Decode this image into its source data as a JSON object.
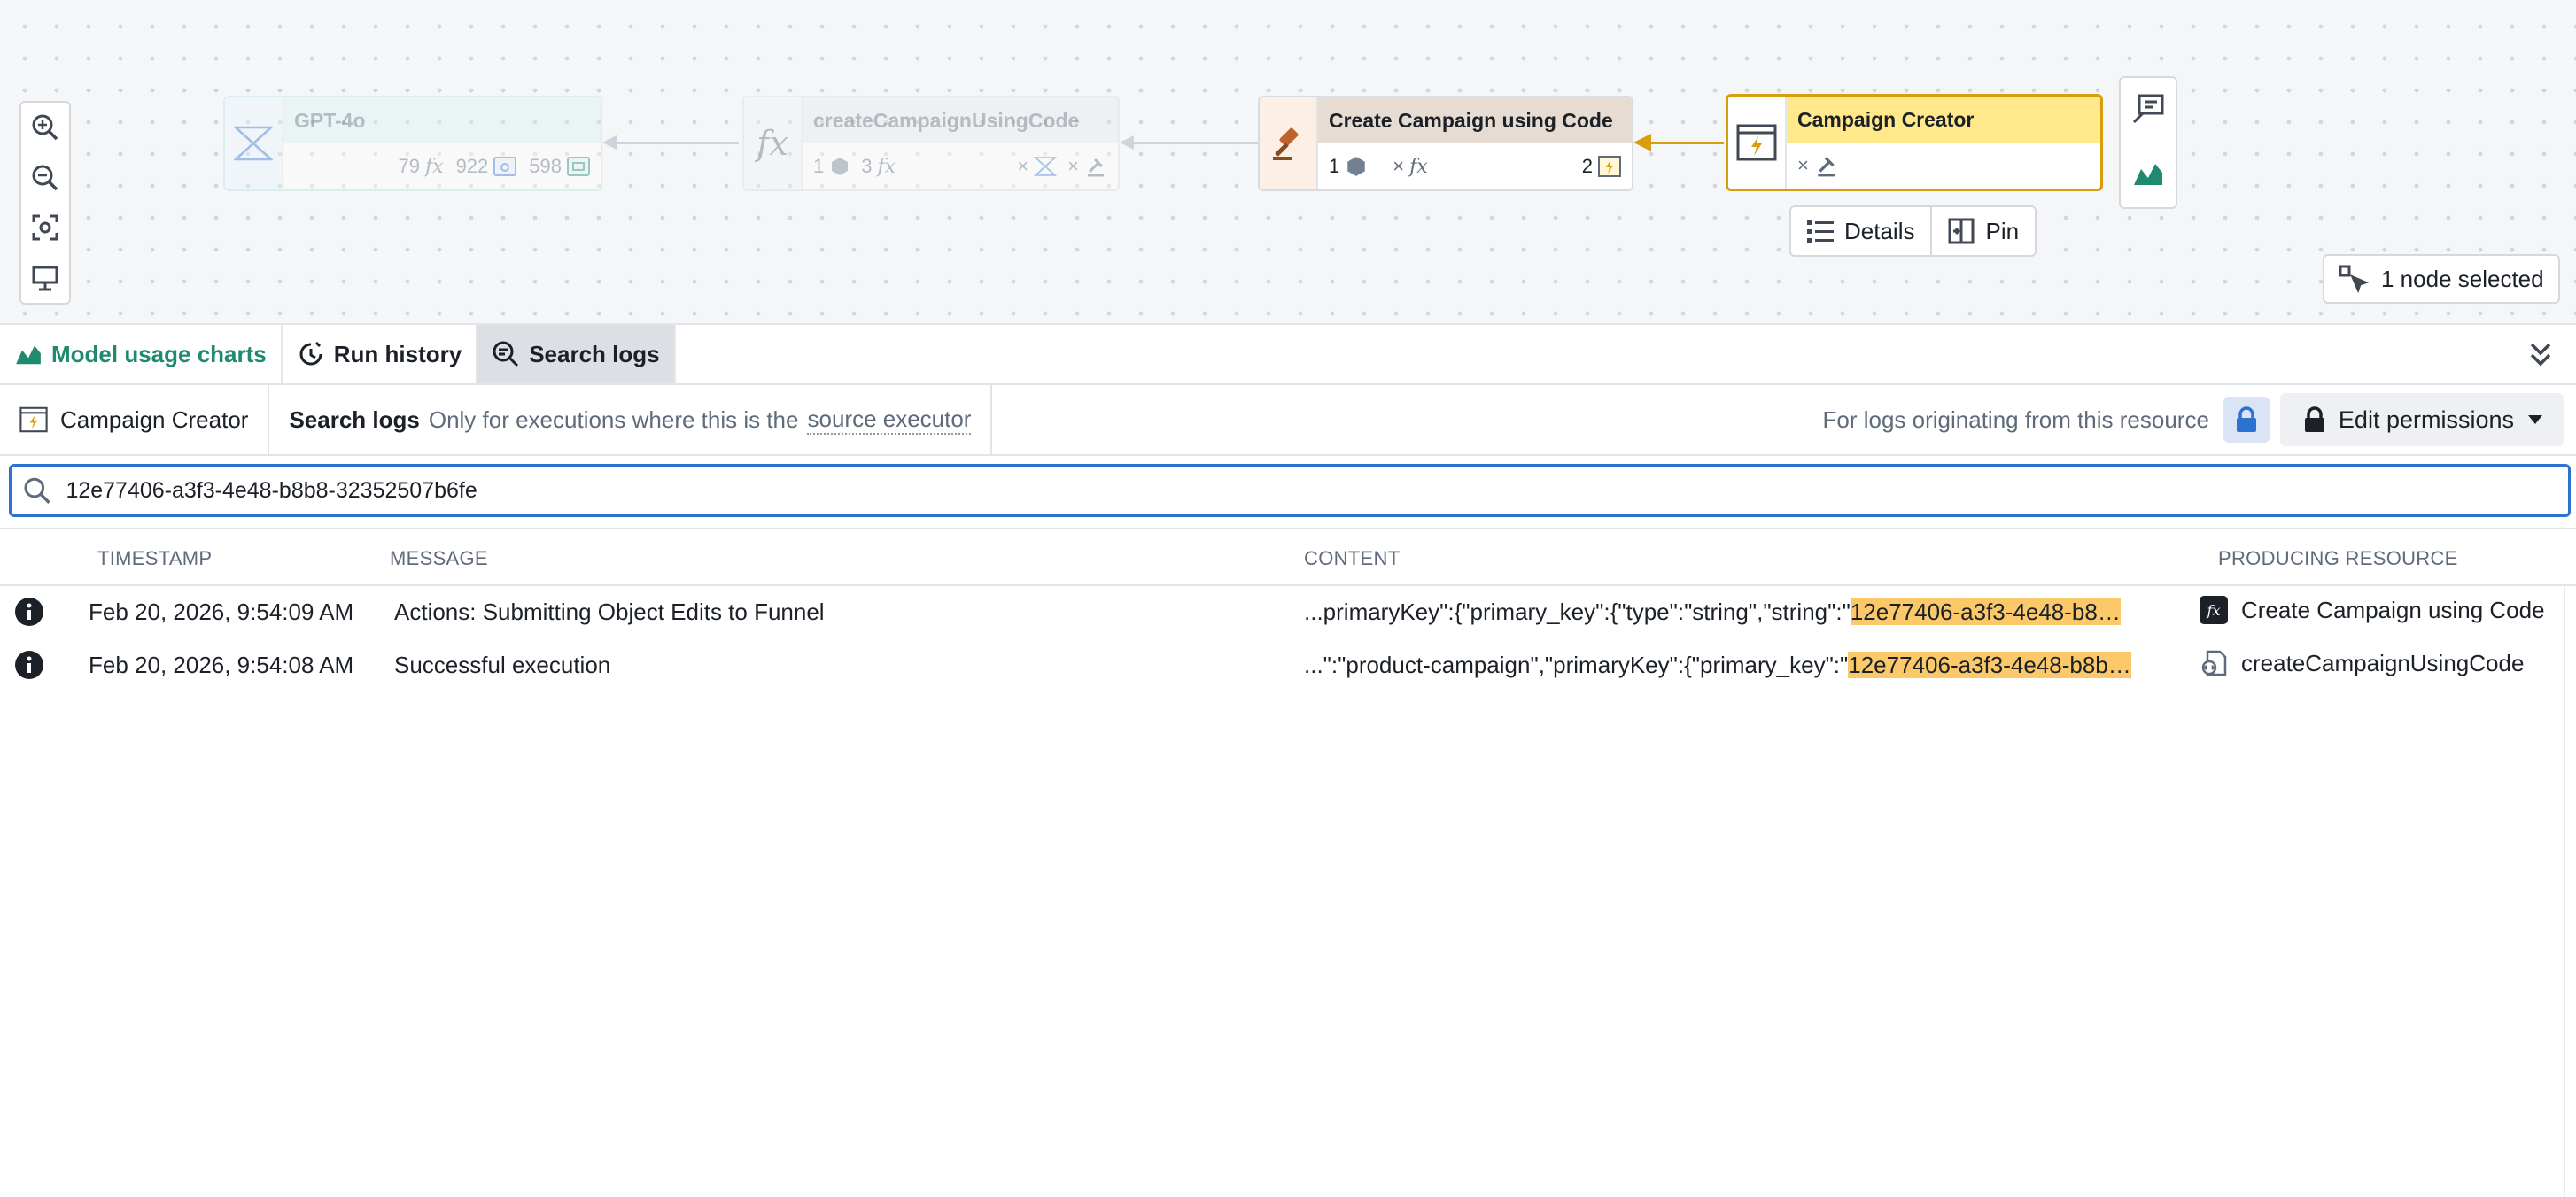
{
  "canvas": {
    "nodes": {
      "gpt": {
        "title": "GPT-4o",
        "stat1": "79",
        "stat2": "922",
        "stat3": "598"
      },
      "create_fn": {
        "title": "createCampaignUsingCode",
        "stat1": "1",
        "stat2": "3"
      },
      "create_action": {
        "title": "Create Campaign using Code",
        "stat1": "1",
        "stat2": "2"
      },
      "campaign_creator": {
        "title": "Campaign Creator"
      }
    },
    "details_label": "Details",
    "pin_label": "Pin",
    "selection_label": "1 node selected",
    "colors": {
      "accent_yellow": "#ffe98a",
      "selected_border": "#d99e0b",
      "edge_active": "#d99e0b"
    }
  },
  "tabs": [
    {
      "label": "Model usage charts",
      "icon": "area-chart-icon"
    },
    {
      "label": "Run history",
      "icon": "run-history-icon"
    },
    {
      "label": "Search logs",
      "icon": "search-logs-icon"
    }
  ],
  "scope": {
    "resource": "Campaign Creator",
    "title": "Search logs",
    "description": "Only for executions where this is the",
    "link": "source executor",
    "right_text": "For logs originating from this resource",
    "edit_permissions": "Edit permissions"
  },
  "search": {
    "value": "12e77406-a3f3-4e48-b8b8-32352507b6fe"
  },
  "table": {
    "columns": [
      "TIMESTAMP",
      "MESSAGE",
      "CONTENT",
      "PRODUCING RESOURCE"
    ],
    "rows": [
      {
        "timestamp": "Feb 20, 2026, 9:54:09 AM",
        "message": "Actions: Submitting Object Edits to Funnel",
        "content_prefix": "...primaryKey\":{\"primary_key\":{\"type\":\"string\",\"string\":\"",
        "content_match": "12e77406-a3f3-4e48-b8…",
        "resource": "Create Campaign using Code"
      },
      {
        "timestamp": "Feb 20, 2026, 9:54:08 AM",
        "message": "Successful execution",
        "content_prefix": "...\":\"product-campaign\",\"primaryKey\":{\"primary_key\":\"",
        "content_match": "12e77406-a3f3-4e48-b8b…",
        "resource": "createCampaignUsingCode"
      }
    ]
  }
}
